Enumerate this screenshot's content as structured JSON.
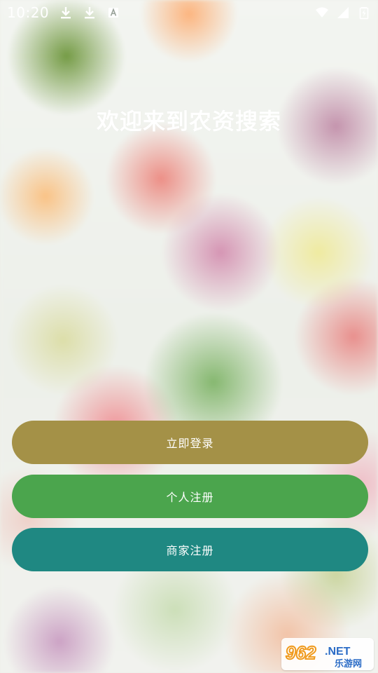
{
  "status_bar": {
    "time": "10:20",
    "icons": [
      "download-icon",
      "download-icon",
      "a-notification-icon",
      "wifi-icon",
      "signal-icon",
      "battery-charging-icon"
    ]
  },
  "welcome": {
    "title": "欢迎来到农资搜索"
  },
  "buttons": {
    "login_label": "立即登录",
    "personal_register_label": "个人注册",
    "merchant_register_label": "商家注册"
  },
  "colors": {
    "login_button": "#a49147",
    "personal_register_button": "#4ba54d",
    "merchant_register_button": "#1f8882"
  },
  "watermark": {
    "brand_number": "962",
    "brand_suffix": ".NET",
    "brand_name": "乐游网"
  }
}
